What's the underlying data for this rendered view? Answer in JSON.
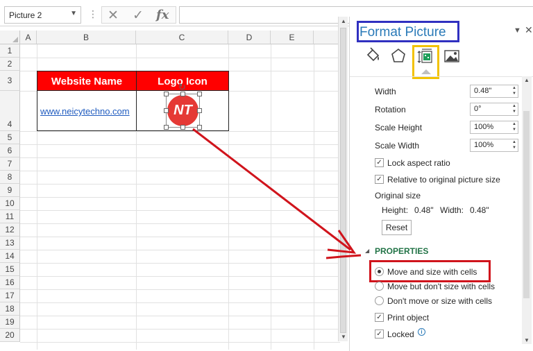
{
  "formula_bar": {
    "name_box": "Picture 2",
    "cancel_icon": "✕",
    "enter_icon": "✓",
    "function_icon": "fx",
    "formula": ""
  },
  "sheet": {
    "columns": [
      "A",
      "B",
      "C",
      "D",
      "E"
    ],
    "rows": [
      "1",
      "2",
      "3",
      "4",
      "5",
      "6",
      "7",
      "8",
      "9",
      "10",
      "11",
      "12",
      "13",
      "14",
      "15",
      "16",
      "17",
      "18",
      "19",
      "20"
    ],
    "header_website": "Website Name",
    "header_logo": "Logo Icon",
    "link_text": "www.neicytechno.com",
    "logo_text": "NT",
    "header_fill": "#ff0000",
    "logo_fill": "#e53935"
  },
  "pane": {
    "title": "Format Picture",
    "tabs": [
      "fill-line-icon",
      "effects-icon",
      "size-properties-icon",
      "picture-icon"
    ],
    "active_tab": "size-properties-icon",
    "width_label": "Width",
    "width_value": "0.48\"",
    "rotation_label": "Rotation",
    "rotation_value": "0°",
    "scale_height_label": "Scale Height",
    "scale_height_value": "100%",
    "scale_width_label": "Scale Width",
    "scale_width_value": "100%",
    "lock_aspect_label": "Lock aspect ratio",
    "lock_aspect_checked": true,
    "relative_label": "Relative to original picture size",
    "relative_checked": true,
    "original_size_label": "Original size",
    "original_height_label": "Height:",
    "original_height_value": "0.48\"",
    "original_width_label": "Width:",
    "original_width_value": "0.48\"",
    "reset_label": "Reset",
    "properties_title": "PROPERTIES",
    "option_move_size": "Move and size with cells",
    "option_move_only": "Move but don't size with cells",
    "option_dont_move": "Don't move or size with cells",
    "selected_option": "Move and size with cells",
    "print_object_label": "Print object",
    "print_object_checked": true,
    "locked_label": "Locked",
    "locked_checked": true
  },
  "annotations": {
    "title_box_color": "#3030c0",
    "tab_box_color": "#f2c200",
    "option_box_color": "#d0141c",
    "arrow_color": "#d0141c"
  }
}
